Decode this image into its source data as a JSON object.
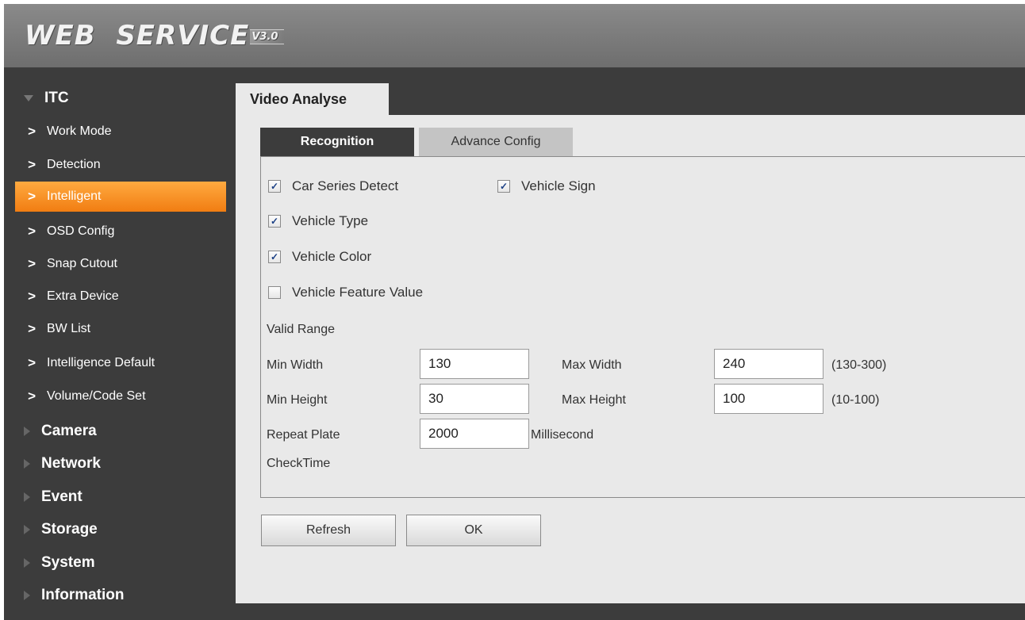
{
  "header": {
    "brand": "WEB  SERVICE",
    "version": "V3.0"
  },
  "sidebar": {
    "itc": "ITC",
    "sub_items": [
      {
        "label": "Work Mode"
      },
      {
        "label": "Detection"
      },
      {
        "label": "Intelligent"
      },
      {
        "label": "OSD Config"
      },
      {
        "label": "Snap Cutout"
      },
      {
        "label": "Extra Device"
      },
      {
        "label": "BW List"
      },
      {
        "label": "Intelligence Default"
      },
      {
        "label": "Volume/Code Set"
      }
    ],
    "active_item": "Intelligent",
    "sections": [
      "Camera",
      "Network",
      "Event",
      "Storage",
      "System",
      "Information"
    ]
  },
  "main": {
    "tab": "Video Analyse",
    "subtabs": {
      "recognition": "Recognition",
      "advance": "Advance Config"
    },
    "checkboxes": {
      "car_series": {
        "label": "Car Series Detect",
        "checked": true
      },
      "vehicle_sign": {
        "label": "Vehicle Sign",
        "checked": true
      },
      "vehicle_type": {
        "label": "Vehicle Type",
        "checked": true
      },
      "vehicle_color": {
        "label": "Vehicle Color",
        "checked": true
      },
      "vehicle_feature": {
        "label": "Vehicle Feature Value",
        "checked": false
      }
    },
    "valid_range": "Valid Range",
    "min_width": {
      "label": "Min Width",
      "value": "130"
    },
    "max_width": {
      "label": "Max Width",
      "value": "240"
    },
    "width_range": "(130-300)",
    "min_height": {
      "label": "Min Height",
      "value": "30"
    },
    "max_height": {
      "label": "Max Height",
      "value": "100"
    },
    "height_range": "(10-100)",
    "repeat_plate": {
      "label_line1": "Repeat Plate",
      "label_line2": "CheckTime",
      "value": "2000",
      "unit": "Millisecond"
    },
    "buttons": {
      "refresh": "Refresh",
      "ok": "OK"
    }
  }
}
